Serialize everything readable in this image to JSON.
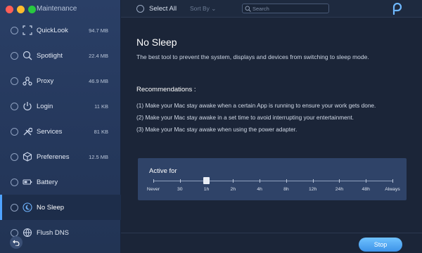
{
  "window": {
    "sidebar_title": "Maintenance"
  },
  "toolbar": {
    "select_all": "Select All",
    "sort_by": "Sort By ⌄",
    "search_placeholder": "Search"
  },
  "sidebar": {
    "items": [
      {
        "label": "QuickLook",
        "size": "94.7 MB",
        "icon": "quicklook-icon"
      },
      {
        "label": "Spotlight",
        "size": "22.4 MB",
        "icon": "search-icon"
      },
      {
        "label": "Proxy",
        "size": "46.9 MB",
        "icon": "proxy-icon"
      },
      {
        "label": "Login",
        "size": "11 KB",
        "icon": "power-icon"
      },
      {
        "label": "Services",
        "size": "81 KB",
        "icon": "tools-icon"
      },
      {
        "label": "Preferenes",
        "size": "12.5 MB",
        "icon": "cube-icon"
      },
      {
        "label": "Battery",
        "size": "",
        "icon": "battery-icon"
      },
      {
        "label": "No Sleep",
        "size": "",
        "icon": "moon-icon",
        "active": true
      },
      {
        "label": "Flush DNS",
        "size": "",
        "icon": "globe-icon"
      }
    ]
  },
  "main": {
    "title": "No Sleep",
    "description": "The best tool to prevent the system, displays and devices from switching to sleep mode.",
    "recommendations_heading": "Recommendations :",
    "recommendations": [
      "(1) Make your Mac stay awake when a certain App is running to ensure your work gets done.",
      "(2) Make your Mac stay awake in a set time to avoid interrupting your entertainment.",
      "(3) Make your Mac stay awake when using the power adapter."
    ],
    "active_for": {
      "label": "Active for",
      "options": [
        "Never",
        "30",
        "1h",
        "2h",
        "4h",
        "8h",
        "12h",
        "24h",
        "48h",
        "Always"
      ],
      "selected": "1h"
    },
    "stop_button": "Stop"
  },
  "colors": {
    "accent": "#4fa3ff",
    "sidebar": "#2a3f66",
    "panel": "#2f4368"
  }
}
